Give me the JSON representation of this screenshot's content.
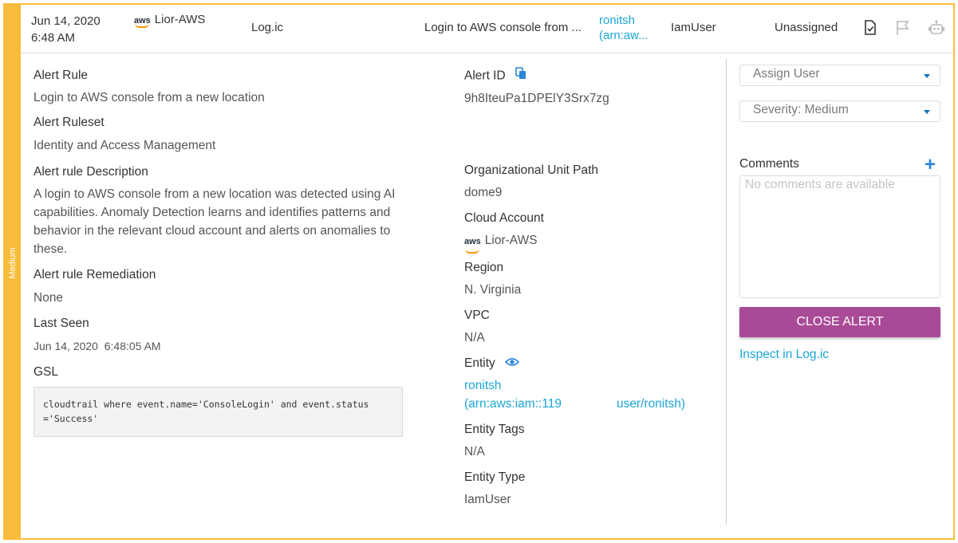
{
  "severity": "Medium",
  "header": {
    "date": "Jun 14, 2020",
    "time": "6:48 AM",
    "aws_logo": "aws",
    "account": "Lior-AWS",
    "vendor": "Log.ic",
    "rule": "Login to AWS console from ...",
    "user_line1": "ronitsh",
    "user_line2": "(arn:aw...",
    "entity_type": "IamUser",
    "assignee": "Unassigned",
    "icons": [
      "document-check-icon",
      "flag-icon",
      "robot-icon"
    ]
  },
  "details": {
    "alert_rule_label": "Alert Rule",
    "alert_rule": "Login to AWS console from a new location",
    "ruleset_label": "Alert Ruleset",
    "ruleset": "Identity and Access Management",
    "description_label": "Alert rule Description",
    "description": "A login to AWS console from a new location was detected using AI capabilities. Anomaly Detection learns and identifies patterns and behavior in the relevant cloud account and alerts on anomalies to these.",
    "remediation_label": "Alert rule Remediation",
    "remediation": "None",
    "last_seen_label": "Last Seen",
    "last_seen": "Jun 14, 2020  6:48:05 AM",
    "gsl_label": "GSL",
    "gsl": "cloudtrail where event.name='ConsoleLogin' and event.status\n='Success'"
  },
  "meta": {
    "alert_id_label": "Alert ID",
    "alert_id": "9h8IteuPa1DPElY3Srx7zg",
    "ou_path_label": "Organizational Unit Path",
    "ou_path": "dome9",
    "cloud_account_label": "Cloud Account",
    "cloud_account": "Lior-AWS",
    "region_label": "Region",
    "region": "N. Virginia",
    "vpc_label": "VPC",
    "vpc": "N/A",
    "entity_label": "Entity",
    "entity_line1": "ronitsh",
    "entity_line2": "(arn:aws:iam::119                user/ronitsh)",
    "entity_tags_label": "Entity Tags",
    "entity_tags": "N/A",
    "entity_type_label": "Entity Type",
    "entity_type": "IamUser"
  },
  "actions": {
    "assign_user": "Assign User",
    "severity": "Severity: Medium",
    "comments_label": "Comments",
    "comments_placeholder": "No comments are available",
    "close_alert": "CLOSE ALERT",
    "inspect_link": "Inspect in Log.ic"
  },
  "colors": {
    "severity_medium": "#f9bc3a",
    "link": "#1ba6d6",
    "close_button": "#a94a97",
    "accent_blue": "#2986d8"
  }
}
